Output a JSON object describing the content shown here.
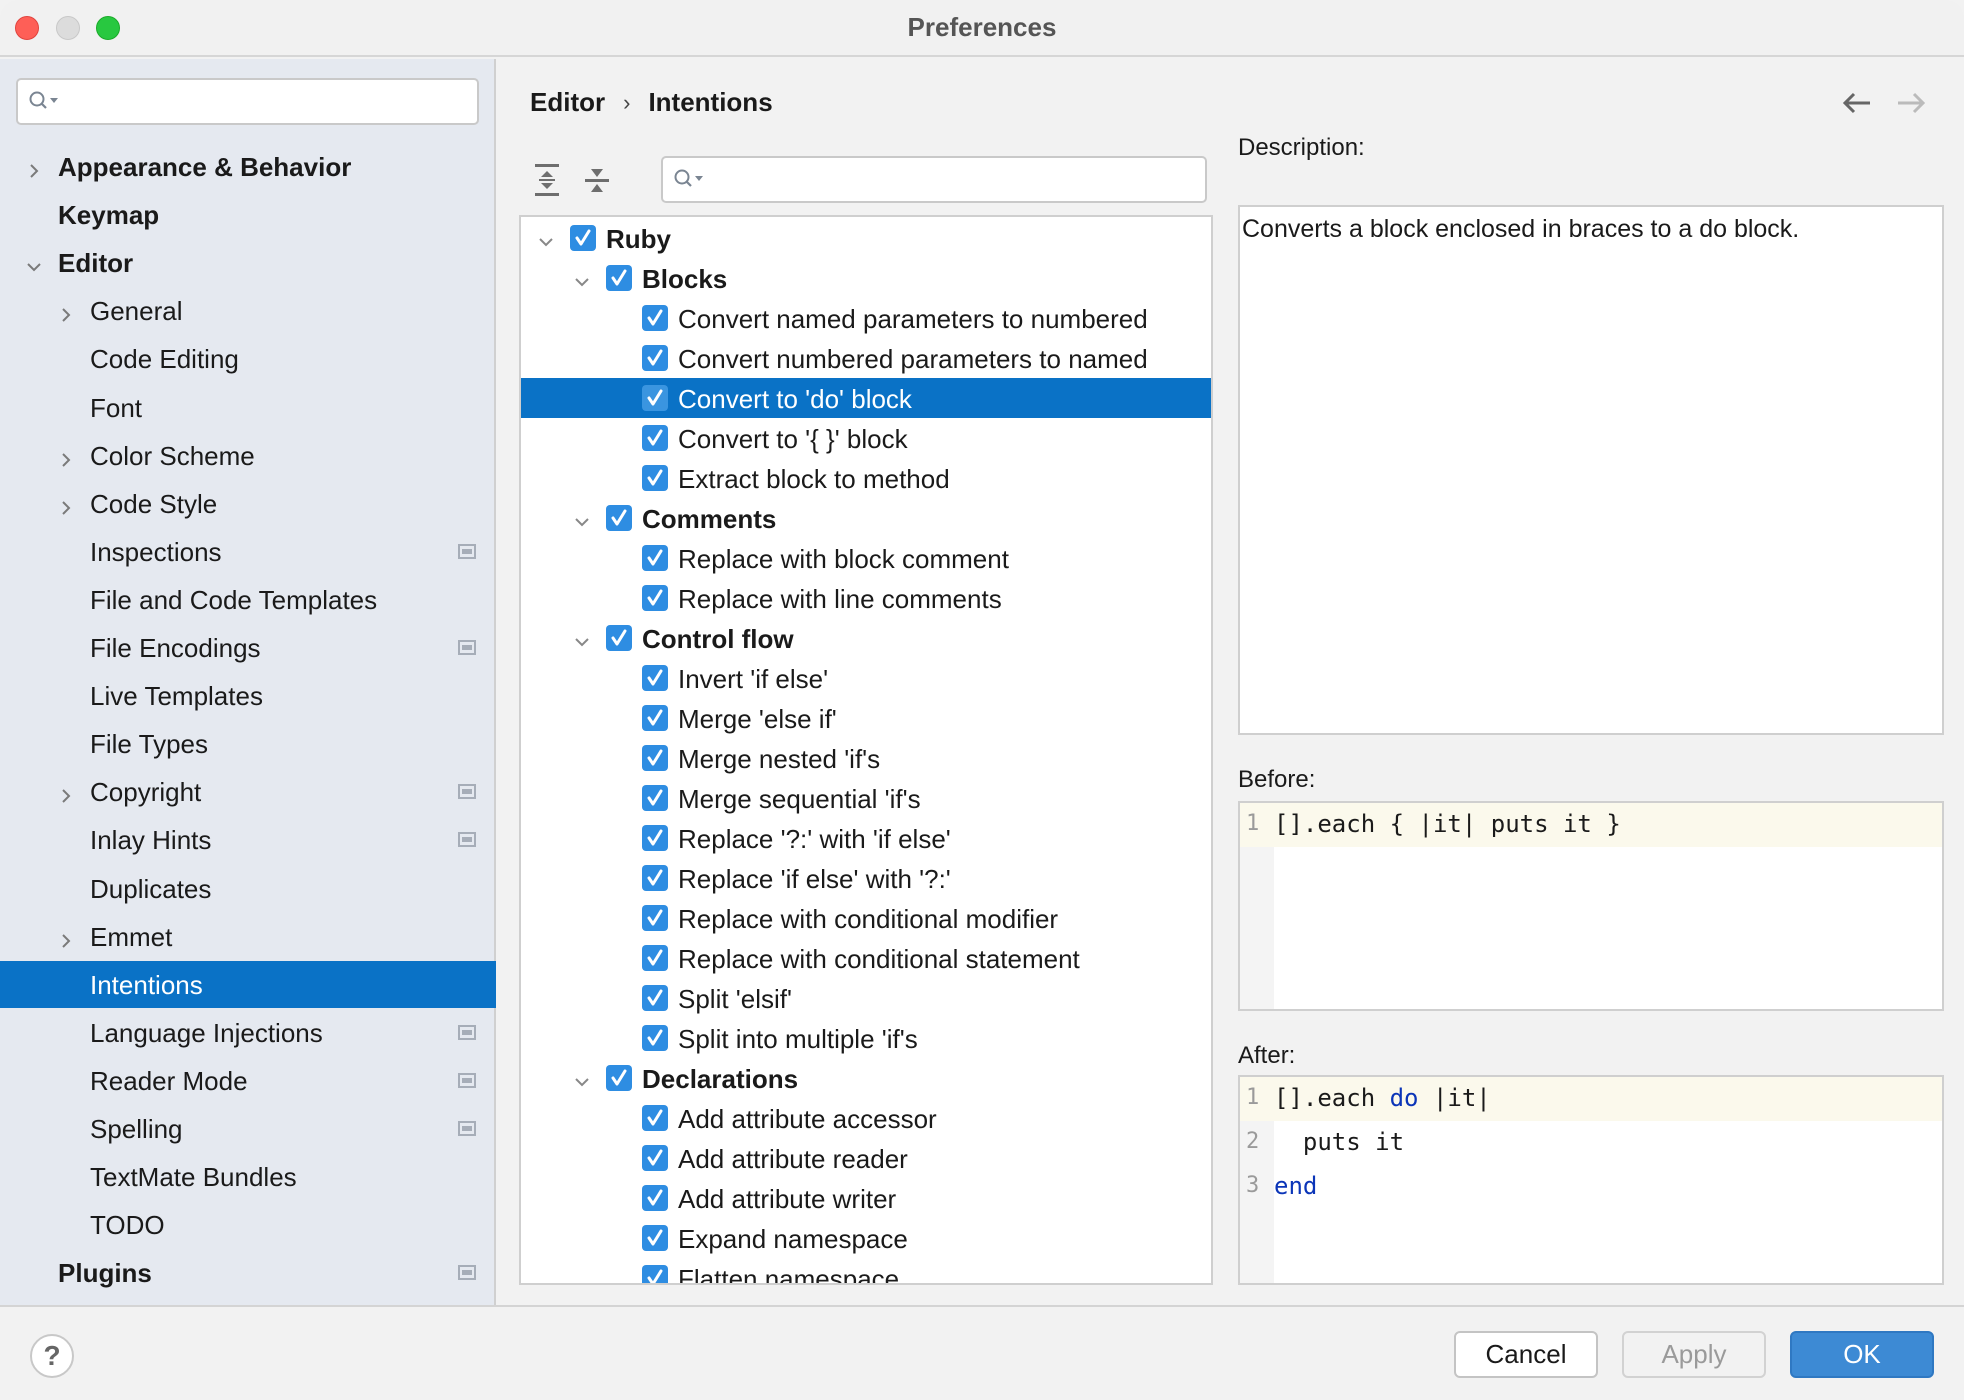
{
  "window": {
    "title": "Preferences"
  },
  "sidebar": {
    "search_placeholder": "",
    "items": [
      {
        "label": "Appearance & Behavior",
        "level": 0,
        "bold": true,
        "chevron": "right",
        "badge": false,
        "selected": false
      },
      {
        "label": "Keymap",
        "level": 0,
        "bold": true,
        "chevron": "none",
        "badge": false,
        "selected": false
      },
      {
        "label": "Editor",
        "level": 0,
        "bold": true,
        "chevron": "down",
        "badge": false,
        "selected": false
      },
      {
        "label": "General",
        "level": 1,
        "bold": false,
        "chevron": "right",
        "badge": false,
        "selected": false
      },
      {
        "label": "Code Editing",
        "level": 1,
        "bold": false,
        "chevron": "none",
        "badge": false,
        "selected": false
      },
      {
        "label": "Font",
        "level": 1,
        "bold": false,
        "chevron": "none",
        "badge": false,
        "selected": false
      },
      {
        "label": "Color Scheme",
        "level": 1,
        "bold": false,
        "chevron": "right",
        "badge": false,
        "selected": false
      },
      {
        "label": "Code Style",
        "level": 1,
        "bold": false,
        "chevron": "right",
        "badge": false,
        "selected": false
      },
      {
        "label": "Inspections",
        "level": 1,
        "bold": false,
        "chevron": "none",
        "badge": true,
        "selected": false
      },
      {
        "label": "File and Code Templates",
        "level": 1,
        "bold": false,
        "chevron": "none",
        "badge": false,
        "selected": false
      },
      {
        "label": "File Encodings",
        "level": 1,
        "bold": false,
        "chevron": "none",
        "badge": true,
        "selected": false
      },
      {
        "label": "Live Templates",
        "level": 1,
        "bold": false,
        "chevron": "none",
        "badge": false,
        "selected": false
      },
      {
        "label": "File Types",
        "level": 1,
        "bold": false,
        "chevron": "none",
        "badge": false,
        "selected": false
      },
      {
        "label": "Copyright",
        "level": 1,
        "bold": false,
        "chevron": "right",
        "badge": true,
        "selected": false
      },
      {
        "label": "Inlay Hints",
        "level": 1,
        "bold": false,
        "chevron": "none",
        "badge": true,
        "selected": false
      },
      {
        "label": "Duplicates",
        "level": 1,
        "bold": false,
        "chevron": "none",
        "badge": false,
        "selected": false
      },
      {
        "label": "Emmet",
        "level": 1,
        "bold": false,
        "chevron": "right",
        "badge": false,
        "selected": false
      },
      {
        "label": "Intentions",
        "level": 1,
        "bold": false,
        "chevron": "none",
        "badge": false,
        "selected": true
      },
      {
        "label": "Language Injections",
        "level": 1,
        "bold": false,
        "chevron": "none",
        "badge": true,
        "selected": false
      },
      {
        "label": "Reader Mode",
        "level": 1,
        "bold": false,
        "chevron": "none",
        "badge": true,
        "selected": false
      },
      {
        "label": "Spelling",
        "level": 1,
        "bold": false,
        "chevron": "none",
        "badge": true,
        "selected": false
      },
      {
        "label": "TextMate Bundles",
        "level": 1,
        "bold": false,
        "chevron": "none",
        "badge": false,
        "selected": false
      },
      {
        "label": "TODO",
        "level": 1,
        "bold": false,
        "chevron": "none",
        "badge": false,
        "selected": false
      },
      {
        "label": "Plugins",
        "level": 0,
        "bold": true,
        "chevron": "none",
        "badge": true,
        "selected": false
      }
    ]
  },
  "breadcrumb": {
    "parent": "Editor",
    "separator": "›",
    "current": "Intentions"
  },
  "navigation": {
    "back_icon": "arrow-left-icon",
    "forward_icon": "arrow-right-icon",
    "forward_enabled": false
  },
  "tree": {
    "search_placeholder": "",
    "rows": [
      {
        "label": "Ruby",
        "level": 0,
        "group": true,
        "expanded": true,
        "checked": true,
        "selected": false
      },
      {
        "label": "Blocks",
        "level": 1,
        "group": true,
        "expanded": true,
        "checked": true,
        "selected": false
      },
      {
        "label": "Convert named parameters to numbered",
        "level": 2,
        "group": false,
        "checked": true,
        "selected": false
      },
      {
        "label": "Convert numbered parameters to named",
        "level": 2,
        "group": false,
        "checked": true,
        "selected": false
      },
      {
        "label": "Convert to 'do' block",
        "level": 2,
        "group": false,
        "checked": true,
        "selected": true
      },
      {
        "label": "Convert to '{ }' block",
        "level": 2,
        "group": false,
        "checked": true,
        "selected": false
      },
      {
        "label": "Extract block to method",
        "level": 2,
        "group": false,
        "checked": true,
        "selected": false
      },
      {
        "label": "Comments",
        "level": 1,
        "group": true,
        "expanded": true,
        "checked": true,
        "selected": false
      },
      {
        "label": "Replace with block comment",
        "level": 2,
        "group": false,
        "checked": true,
        "selected": false
      },
      {
        "label": "Replace with line comments",
        "level": 2,
        "group": false,
        "checked": true,
        "selected": false
      },
      {
        "label": "Control flow",
        "level": 1,
        "group": true,
        "expanded": true,
        "checked": true,
        "selected": false
      },
      {
        "label": "Invert 'if else'",
        "level": 2,
        "group": false,
        "checked": true,
        "selected": false
      },
      {
        "label": "Merge 'else if'",
        "level": 2,
        "group": false,
        "checked": true,
        "selected": false
      },
      {
        "label": "Merge nested 'if's",
        "level": 2,
        "group": false,
        "checked": true,
        "selected": false
      },
      {
        "label": "Merge sequential 'if's",
        "level": 2,
        "group": false,
        "checked": true,
        "selected": false
      },
      {
        "label": "Replace '?:' with 'if else'",
        "level": 2,
        "group": false,
        "checked": true,
        "selected": false
      },
      {
        "label": "Replace 'if else' with '?:'",
        "level": 2,
        "group": false,
        "checked": true,
        "selected": false
      },
      {
        "label": "Replace with conditional modifier",
        "level": 2,
        "group": false,
        "checked": true,
        "selected": false
      },
      {
        "label": "Replace with conditional statement",
        "level": 2,
        "group": false,
        "checked": true,
        "selected": false
      },
      {
        "label": "Split 'elsif'",
        "level": 2,
        "group": false,
        "checked": true,
        "selected": false
      },
      {
        "label": "Split into multiple 'if's",
        "level": 2,
        "group": false,
        "checked": true,
        "selected": false
      },
      {
        "label": "Declarations",
        "level": 1,
        "group": true,
        "expanded": true,
        "checked": true,
        "selected": false
      },
      {
        "label": "Add attribute accessor",
        "level": 2,
        "group": false,
        "checked": true,
        "selected": false
      },
      {
        "label": "Add attribute reader",
        "level": 2,
        "group": false,
        "checked": true,
        "selected": false
      },
      {
        "label": "Add attribute writer",
        "level": 2,
        "group": false,
        "checked": true,
        "selected": false
      },
      {
        "label": "Expand namespace",
        "level": 2,
        "group": false,
        "checked": true,
        "selected": false
      },
      {
        "label": "Flatten namespace",
        "level": 2,
        "group": false,
        "checked": true,
        "selected": false
      }
    ]
  },
  "details": {
    "description_label": "Description:",
    "description_text": "Converts a block enclosed in braces to a do block.",
    "before_label": "Before:",
    "before_lines": [
      {
        "num": "1",
        "segments": [
          {
            "text": "[].each { |it| puts it }",
            "kw": false
          }
        ]
      }
    ],
    "after_label": "After:",
    "after_lines": [
      {
        "num": "1",
        "segments": [
          {
            "text": "[].each ",
            "kw": false
          },
          {
            "text": "do",
            "kw": true
          },
          {
            "text": " |it|",
            "kw": false
          }
        ]
      },
      {
        "num": "2",
        "segments": [
          {
            "text": "  puts it",
            "kw": false
          }
        ]
      },
      {
        "num": "3",
        "segments": [
          {
            "text": "end",
            "kw": true
          }
        ]
      }
    ]
  },
  "footer": {
    "help_label": "?",
    "cancel_label": "Cancel",
    "apply_label": "Apply",
    "ok_label": "OK"
  },
  "colors": {
    "selection": "#0a72c6",
    "checkbox": "#2e8de2",
    "keyword": "#0b35b8",
    "ok_button": "#3d8ad4"
  }
}
